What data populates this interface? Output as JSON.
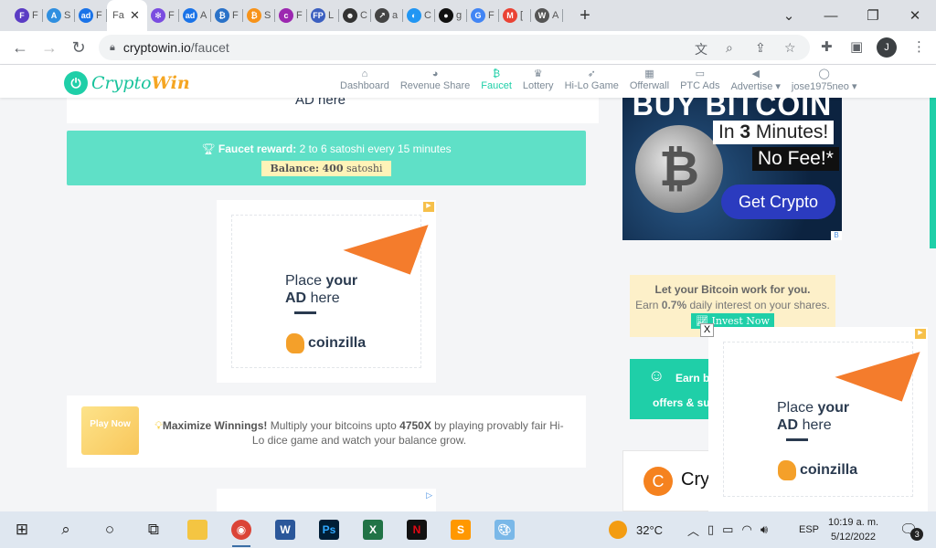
{
  "browser": {
    "tabs": [
      {
        "icon": "F",
        "color": "#5b3cc4",
        "title": "F"
      },
      {
        "icon": "A",
        "color": "#2f8fe0",
        "title": "S"
      },
      {
        "icon": "ad",
        "color": "#1a73e8",
        "title": "F"
      },
      {
        "icon": "✻",
        "color": "#7a4ce0",
        "title": "F"
      },
      {
        "icon": "ad",
        "color": "#1a73e8",
        "title": "A"
      },
      {
        "icon": "₿",
        "color": "#2a72c8",
        "title": "F"
      },
      {
        "icon": "₿",
        "color": "#f7931a",
        "title": "S"
      },
      {
        "icon": "c",
        "color": "#9c27b0",
        "title": "F"
      },
      {
        "icon": "FP",
        "color": "#3b5fc0",
        "title": "L"
      },
      {
        "icon": "☻",
        "color": "#333333",
        "title": "C"
      },
      {
        "icon": "↗",
        "color": "#444444",
        "title": "a"
      },
      {
        "icon": "◐",
        "color": "#2196f3",
        "title": "C"
      },
      {
        "icon": "●",
        "color": "#111111",
        "title": "g"
      },
      {
        "icon": "G",
        "color": "#4285f4",
        "title": "F"
      },
      {
        "icon": "M",
        "color": "#ea4335",
        "title": "["
      },
      {
        "icon": "W",
        "color": "#555555",
        "title": "A"
      }
    ],
    "active_tab": {
      "title": "Fa",
      "close": "✕"
    },
    "new_tab": "+",
    "url_domain": "cryptowin.io",
    "url_path": "/faucet",
    "profile_initial": "J",
    "window_controls": [
      "⌄",
      "—",
      "❐",
      "✕"
    ]
  },
  "site": {
    "logo_text_a": "Crypto",
    "logo_text_b": "Win",
    "nav": [
      {
        "icon": "⌂",
        "label": "Dashboard"
      },
      {
        "icon": "◕",
        "label": "Revenue Share"
      },
      {
        "icon": "₿",
        "label": "Faucet"
      },
      {
        "icon": "♛",
        "label": "Lottery"
      },
      {
        "icon": "➶",
        "label": "Hi-Lo Game"
      },
      {
        "icon": "▦",
        "label": "Offerwall"
      },
      {
        "icon": "▭",
        "label": "PTC Ads"
      },
      {
        "icon": "◀",
        "label": "Advertise ▾"
      },
      {
        "icon": "◯",
        "label": "jose1975neo ▾"
      }
    ],
    "top_ad_partial": "AD here",
    "faucet_reward_label": "Faucet reward:",
    "faucet_reward_value": "2 to 6 satoshi every 15 minutes",
    "balance_label": "Balance:",
    "balance_value": "400",
    "balance_unit": "satoshi",
    "ad": {
      "line1a": "Place ",
      "line1b": "your",
      "line2a": "AD ",
      "line2b": "here",
      "brand": "coinzilla"
    },
    "play": {
      "button": "Play Now",
      "bold1": "Maximize Winnings!",
      "text1": " Multiply your bitcoins upto ",
      "bold2": "4750X",
      "text2": " by playing provably fair Hi-Lo dice game and watch your balance grow."
    },
    "btc_ad": {
      "headline": "BUY BITCOIN",
      "line1a": "In ",
      "line1b": "3",
      "line1c": " Minutes!",
      "line2": "No Fee!*",
      "cta": "Get Crypto",
      "corner": "B"
    },
    "invest": {
      "title": "Let your Bitcoin work for you.",
      "text_a": "Earn ",
      "text_b": "0.7%",
      "text_c": " daily interest on your shares.",
      "button": "Invest Now"
    },
    "earn_partial_1": "Earn b",
    "earn_partial_2": "offers & su",
    "partial_brand": "Cry",
    "popup_close": "X"
  },
  "taskbar": {
    "weather": "32°C",
    "lang": "ESP",
    "time": "10:19 a. m.",
    "date": "5/12/2022",
    "notifications": "3"
  }
}
